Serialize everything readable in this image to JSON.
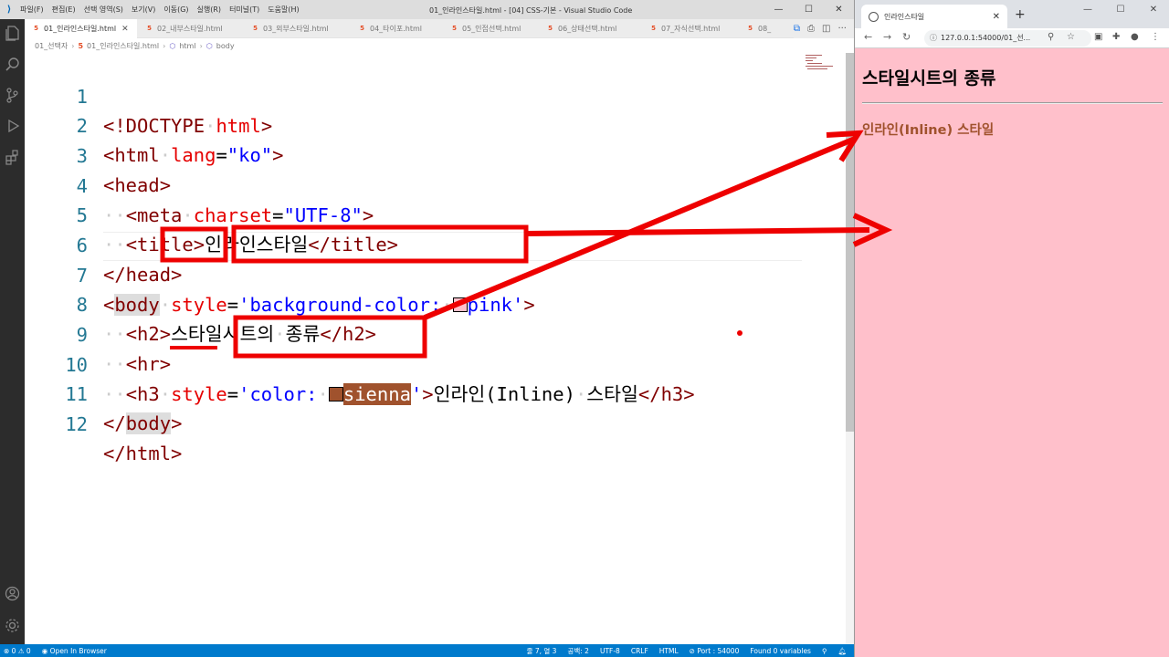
{
  "vscode": {
    "menu": [
      "파일(F)",
      "편집(E)",
      "선택 영역(S)",
      "보기(V)",
      "이동(G)",
      "실행(R)",
      "터미널(T)",
      "도움말(H)"
    ],
    "window_title": "01_인라인스타일.html - [04] CSS-기본 - Visual Studio Code",
    "tabs": [
      {
        "label": "01_인라인스타일.html"
      },
      {
        "label": "02_내부스타일.html"
      },
      {
        "label": "03_외부스타일.html"
      },
      {
        "label": "04_타이포.html"
      },
      {
        "label": "05_인접선택.html"
      },
      {
        "label": "06_상태선택.html"
      },
      {
        "label": "07_자식선택.html"
      },
      {
        "label": "08_"
      }
    ],
    "breadcrumb": [
      "01_선택자",
      "01_인라인스타일.html",
      "html",
      "body"
    ],
    "line_numbers": [
      "1",
      "2",
      "3",
      "4",
      "5",
      "6",
      "7",
      "8",
      "9",
      "10",
      "11",
      "12"
    ],
    "code": {
      "l1_doctype": "<!DOCTYPE",
      "l1_html": "html",
      "l1_close": ">",
      "l2_open": "<html",
      "l2_attr": "lang",
      "l2_eq": "=",
      "l2_val": "\"ko\"",
      "l2_close": ">",
      "l3": "<head>",
      "l4_open": "<meta",
      "l4_attr": "charset",
      "l4_eq": "=",
      "l4_val": "\"UTF-8\"",
      "l4_close": ">",
      "l5_open": "<title>",
      "l5_text": "인라인스타일",
      "l5_close": "</title>",
      "l6": "</head>",
      "l7_lt": "<",
      "l7_tag": "body",
      "l7_attr": "style",
      "l7_eq": "=",
      "l7_q1": "'",
      "l7_prop": "background-color:",
      "l7_color": "pink",
      "l7_q2": "'",
      "l7_close": ">",
      "l8_open": "<h2>",
      "l8_text1": "스타일시트의",
      "l8_text2": "종류",
      "l8_close": "</h2>",
      "l9": "<hr>",
      "l10_open": "<h3",
      "l10_attr": "style",
      "l10_eq": "=",
      "l10_q1": "'",
      "l10_prop": "color:",
      "l10_color": "sienna",
      "l10_q2": "'",
      "l10_gt": ">",
      "l10_text1": "인라인(Inline)",
      "l10_text2": "스타일",
      "l10_close": "</h3>",
      "l11_lt": "</",
      "l11_tag": "body",
      "l11_gt": ">",
      "l12": "</html>"
    },
    "swatch_colors": {
      "pink": "#ffc0cb",
      "sienna": "#a0522d"
    },
    "statusbar": {
      "problems": "⊗ 0 ⚠ 0",
      "open_in_browser": "Open In Browser",
      "position": "줄 7, 열 3",
      "spaces": "공백: 2",
      "encoding": "UTF-8",
      "eol": "CRLF",
      "language": "HTML",
      "port": "Port : 54000",
      "variables": "Found 0 variables"
    },
    "colors": {
      "statusbar": "#007acc",
      "activitybar": "#2c2c2c",
      "annotation": "#ee0000"
    }
  },
  "browser": {
    "tab_title": "인라인스타일",
    "url": "127.0.0.1:54000/01_선...",
    "page_h2": "스타일시트의 종류",
    "page_h3": "인라인(Inline) 스타일",
    "background": "#ffc0cb",
    "h3_color": "#a0522d"
  }
}
